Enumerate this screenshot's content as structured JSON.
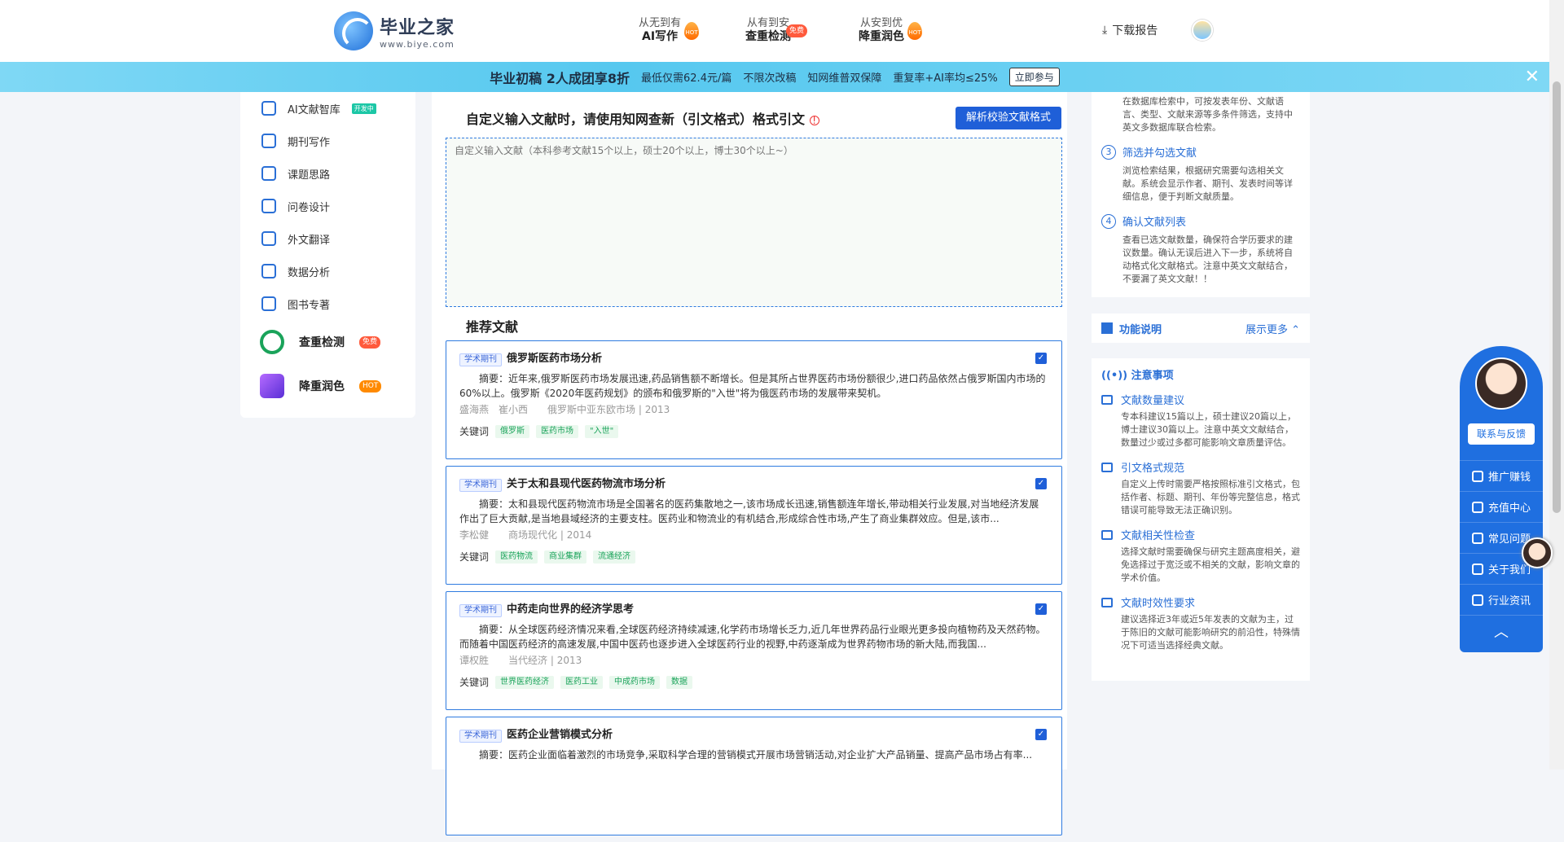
{
  "header": {
    "logo_title": "毕业之家",
    "logo_url": "www.biye.com",
    "nav": [
      {
        "sub": "从无到有",
        "main": "AI写作",
        "tag": "HOT"
      },
      {
        "sub": "从有到安",
        "main": "查重检测",
        "tag": "免费"
      },
      {
        "sub": "从安到优",
        "main": "降重润色",
        "tag": "HOT"
      }
    ],
    "download": "下载报告"
  },
  "promo": {
    "headline": "毕业初稿 2人成团享8折",
    "items": [
      "最低仅需62.4元/篇",
      "不限次改稿",
      "知网维普双保障",
      "重复率+AI率均≤25%"
    ],
    "join": "立即参与"
  },
  "leftnav": {
    "items": [
      {
        "label": "AI文献智库",
        "tag": "开发中"
      },
      {
        "label": "期刊写作"
      },
      {
        "label": "课题思路"
      },
      {
        "label": "问卷设计"
      },
      {
        "label": "外文翻译"
      },
      {
        "label": "数据分析"
      },
      {
        "label": "图书专著"
      }
    ],
    "big": [
      {
        "label": "查重检测",
        "tag": "免费"
      },
      {
        "label": "降重润色",
        "tag": "HOT"
      }
    ]
  },
  "main": {
    "custom_title": "自定义输入文献时，请使用知网查新（引文格式）格式引文",
    "parse_button": "解析校验文献格式",
    "placeholder": "自定义输入文献（本科参考文献15个以上，硕士20个以上，博士30个以上~）",
    "rec_title": "推荐文献",
    "type_label": "学术期刊",
    "kw_label": "关键词",
    "cards": [
      {
        "title": "俄罗斯医药市场分析",
        "abstract": "摘要：近年来,俄罗斯医药市场发展迅速,药品销售额不断增长。但是其所占世界医药市场份额很少,进口药品依然占俄罗斯国内市场的60%以上。俄罗斯《2020年医药规划》的颁布和俄罗斯的\"入世\"将为俄医药市场的发展带来契机。",
        "authors": "盛海燕　崔小西",
        "source": "俄罗斯中亚东欧市场 | 2013",
        "keywords": [
          "俄罗斯",
          "医药市场",
          "\"入世\""
        ]
      },
      {
        "title": "关于太和县现代医药物流市场分析",
        "abstract": "摘要：太和县现代医药物流市场是全国著名的医药集散地之一,该市场成长迅速,销售额连年增长,带动相关行业发展,对当地经济发展作出了巨大贡献,是当地县域经济的主要支柱。医药业和物流业的有机结合,形成综合性市场,产生了商业集群效应。但是,该市...",
        "authors": "李松健",
        "source": "商场现代化 | 2014",
        "keywords": [
          "医药物流",
          "商业集群",
          "流通经济"
        ]
      },
      {
        "title": "中药走向世界的经济学思考",
        "abstract": "摘要：从全球医药经济情况来看,全球医药经济持续减速,化学药市场增长乏力,近几年世界药品行业眼光更多投向植物药及天然药物。而随着中国医药经济的高速发展,中国中医药也逐步进入全球医药行业的视野,中药逐渐成为世界药物市场的新大陆,而我国...",
        "authors": "谭权胜",
        "source": "当代经济 | 2013",
        "keywords": [
          "世界医药经济",
          "医药工业",
          "中成药市场",
          "数据"
        ]
      },
      {
        "title": "医药企业营销模式分析",
        "abstract": "摘要：医药企业面临着激烈的市场竞争,采取科学合理的营销模式开展市场营销活动,对企业扩大产品销量、提高产品市场占有率...",
        "authors": "",
        "source": "",
        "keywords": []
      }
    ]
  },
  "right": {
    "intro": "在数据库检索中，可按发表年份、文献语言、类型、文献来源等多条件筛选，支持中英文多数据库联合检索。",
    "steps": [
      {
        "n": "3",
        "title": "筛选并勾选文献",
        "body": "浏览检索结果，根据研究需要勾选相关文献。系统会显示作者、期刊、发表时间等详细信息，便于判断文献质量。"
      },
      {
        "n": "4",
        "title": "确认文献列表",
        "body": "查看已选文献数量，确保符合学历要求的建议数量。确认无误后进入下一步，系统将自动格式化文献格式。注意中英文文献结合，不要漏了英文文献！！"
      }
    ],
    "func": "功能说明",
    "more": "展示更多",
    "notes_title": "注意事项",
    "notes": [
      {
        "title": "文献数量建议",
        "body": "专本科建议15篇以上，硕士建议20篇以上，博士建议30篇以上。注意中英文文献结合，数量过少或过多都可能影响文章质量评估。"
      },
      {
        "title": "引文格式规范",
        "body": "自定义上传时需要严格按照标准引文格式，包括作者、标题、期刊、年份等完整信息，格式错误可能导致无法正确识别。"
      },
      {
        "title": "文献相关性检查",
        "body": "选择文献时需要确保与研究主题高度相关，避免选择过于宽泛或不相关的文献，影响文章的学术价值。"
      },
      {
        "title": "文献时效性要求",
        "body": "建议选择近3年或近5年发表的文献为主，过于陈旧的文献可能影响研究的前沿性，特殊情况下可适当选择经典文献。"
      }
    ]
  },
  "float": {
    "contact": "联系与反馈",
    "items": [
      "推广赚钱",
      "充值中心",
      "常见问题",
      "关于我们",
      "行业资讯"
    ]
  }
}
